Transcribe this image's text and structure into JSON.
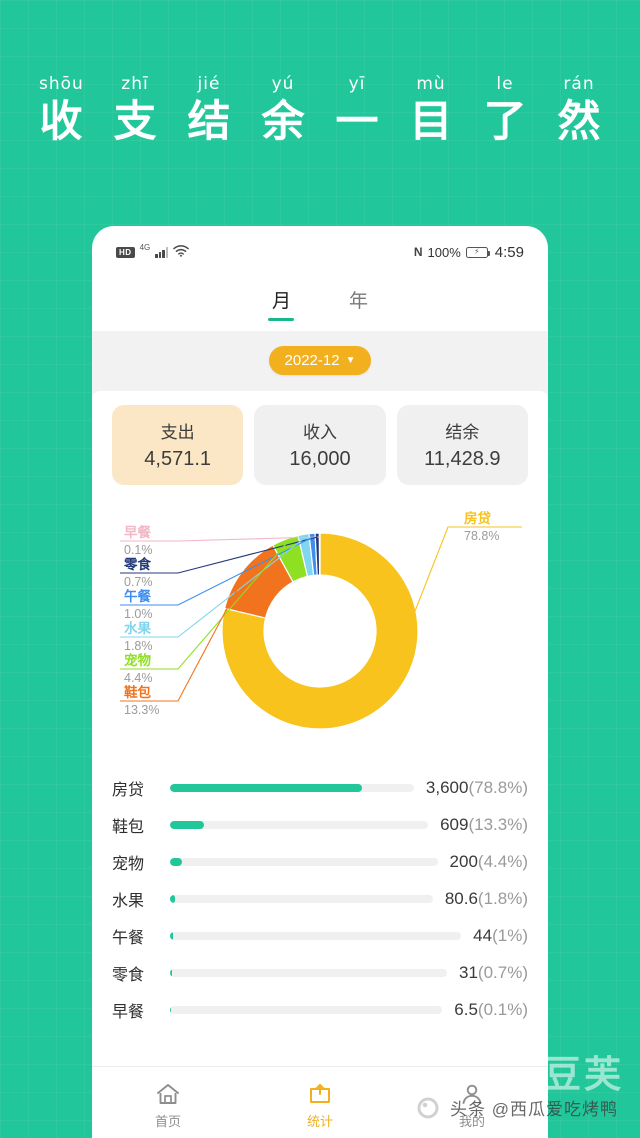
{
  "poster": {
    "background_color": "#21c79a",
    "pinyin": [
      "shōu",
      "zhī",
      "jié",
      "yú",
      "yī",
      "mù",
      "le",
      "rán"
    ],
    "title_chars": [
      "收",
      "支",
      "结",
      "余",
      "一",
      "目",
      "了",
      "然"
    ],
    "title_text": "收支结余一目了然"
  },
  "status_bar": {
    "hd_label": "HD",
    "network_label": "4G",
    "signal_icon": "signal-bars-icon",
    "wifi_icon": "wifi-icon",
    "nfc_icon": "N",
    "battery_percent": "100%",
    "battery_icon": "battery-charging-icon",
    "time": "4:59"
  },
  "tabs": [
    {
      "label": "月",
      "active": true
    },
    {
      "label": "年",
      "active": false
    }
  ],
  "date_selector": {
    "value": "2022-12",
    "caret_icon": "chevron-down-icon",
    "color": "#f2b01e"
  },
  "summary_cards": [
    {
      "label": "支出",
      "value": "4,571.1",
      "active": true
    },
    {
      "label": "收入",
      "value": "16,000",
      "active": false
    },
    {
      "label": "结余",
      "value": "11,428.9",
      "active": false
    }
  ],
  "chart_data": {
    "type": "pie",
    "title": "",
    "donut": true,
    "categories": [
      "房贷",
      "鞋包",
      "宠物",
      "水果",
      "午餐",
      "零食",
      "早餐"
    ],
    "values": [
      3600,
      609,
      200,
      80.6,
      44,
      31,
      6.5
    ],
    "percents": [
      78.8,
      13.3,
      4.4,
      1.8,
      1.0,
      0.7,
      0.1
    ],
    "percent_labels": [
      "78.8%",
      "13.3%",
      "4.4%",
      "1.8%",
      "1.0%",
      "0.7%",
      "0.1%"
    ],
    "colors": [
      "#f7c31c",
      "#f2731e",
      "#8fdf22",
      "#7fd6ee",
      "#3d8ef0",
      "#253a7a",
      "#f3b6c5"
    ],
    "legend_position": "callout-labels",
    "total": 4571.1
  },
  "breakdown": {
    "rows": [
      {
        "name": "房贷",
        "amount": "3,600",
        "percent": "(78.8%)",
        "bar": 78.8
      },
      {
        "name": "鞋包",
        "amount": "609",
        "percent": "(13.3%)",
        "bar": 13.3
      },
      {
        "name": "宠物",
        "amount": "200",
        "percent": "(4.4%)",
        "bar": 4.4
      },
      {
        "name": "水果",
        "amount": "80.6",
        "percent": "(1.8%)",
        "bar": 1.8
      },
      {
        "name": "午餐",
        "amount": "44",
        "percent": "(1%)",
        "bar": 1.0
      },
      {
        "name": "零食",
        "amount": "31",
        "percent": "(0.7%)",
        "bar": 0.7
      },
      {
        "name": "早餐",
        "amount": "6.5",
        "percent": "(0.1%)",
        "bar": 0.1
      }
    ],
    "bar_color": "#21c79a"
  },
  "bottom_nav": [
    {
      "label": "首页",
      "icon": "home-icon",
      "active": false
    },
    {
      "label": "统计",
      "icon": "chart-upload-icon",
      "active": true
    },
    {
      "label": "我的",
      "icon": "person-icon",
      "active": false
    }
  ],
  "watermark": {
    "big": "豆芙",
    "small": "头条 @西瓜爱吃烤鸭"
  }
}
